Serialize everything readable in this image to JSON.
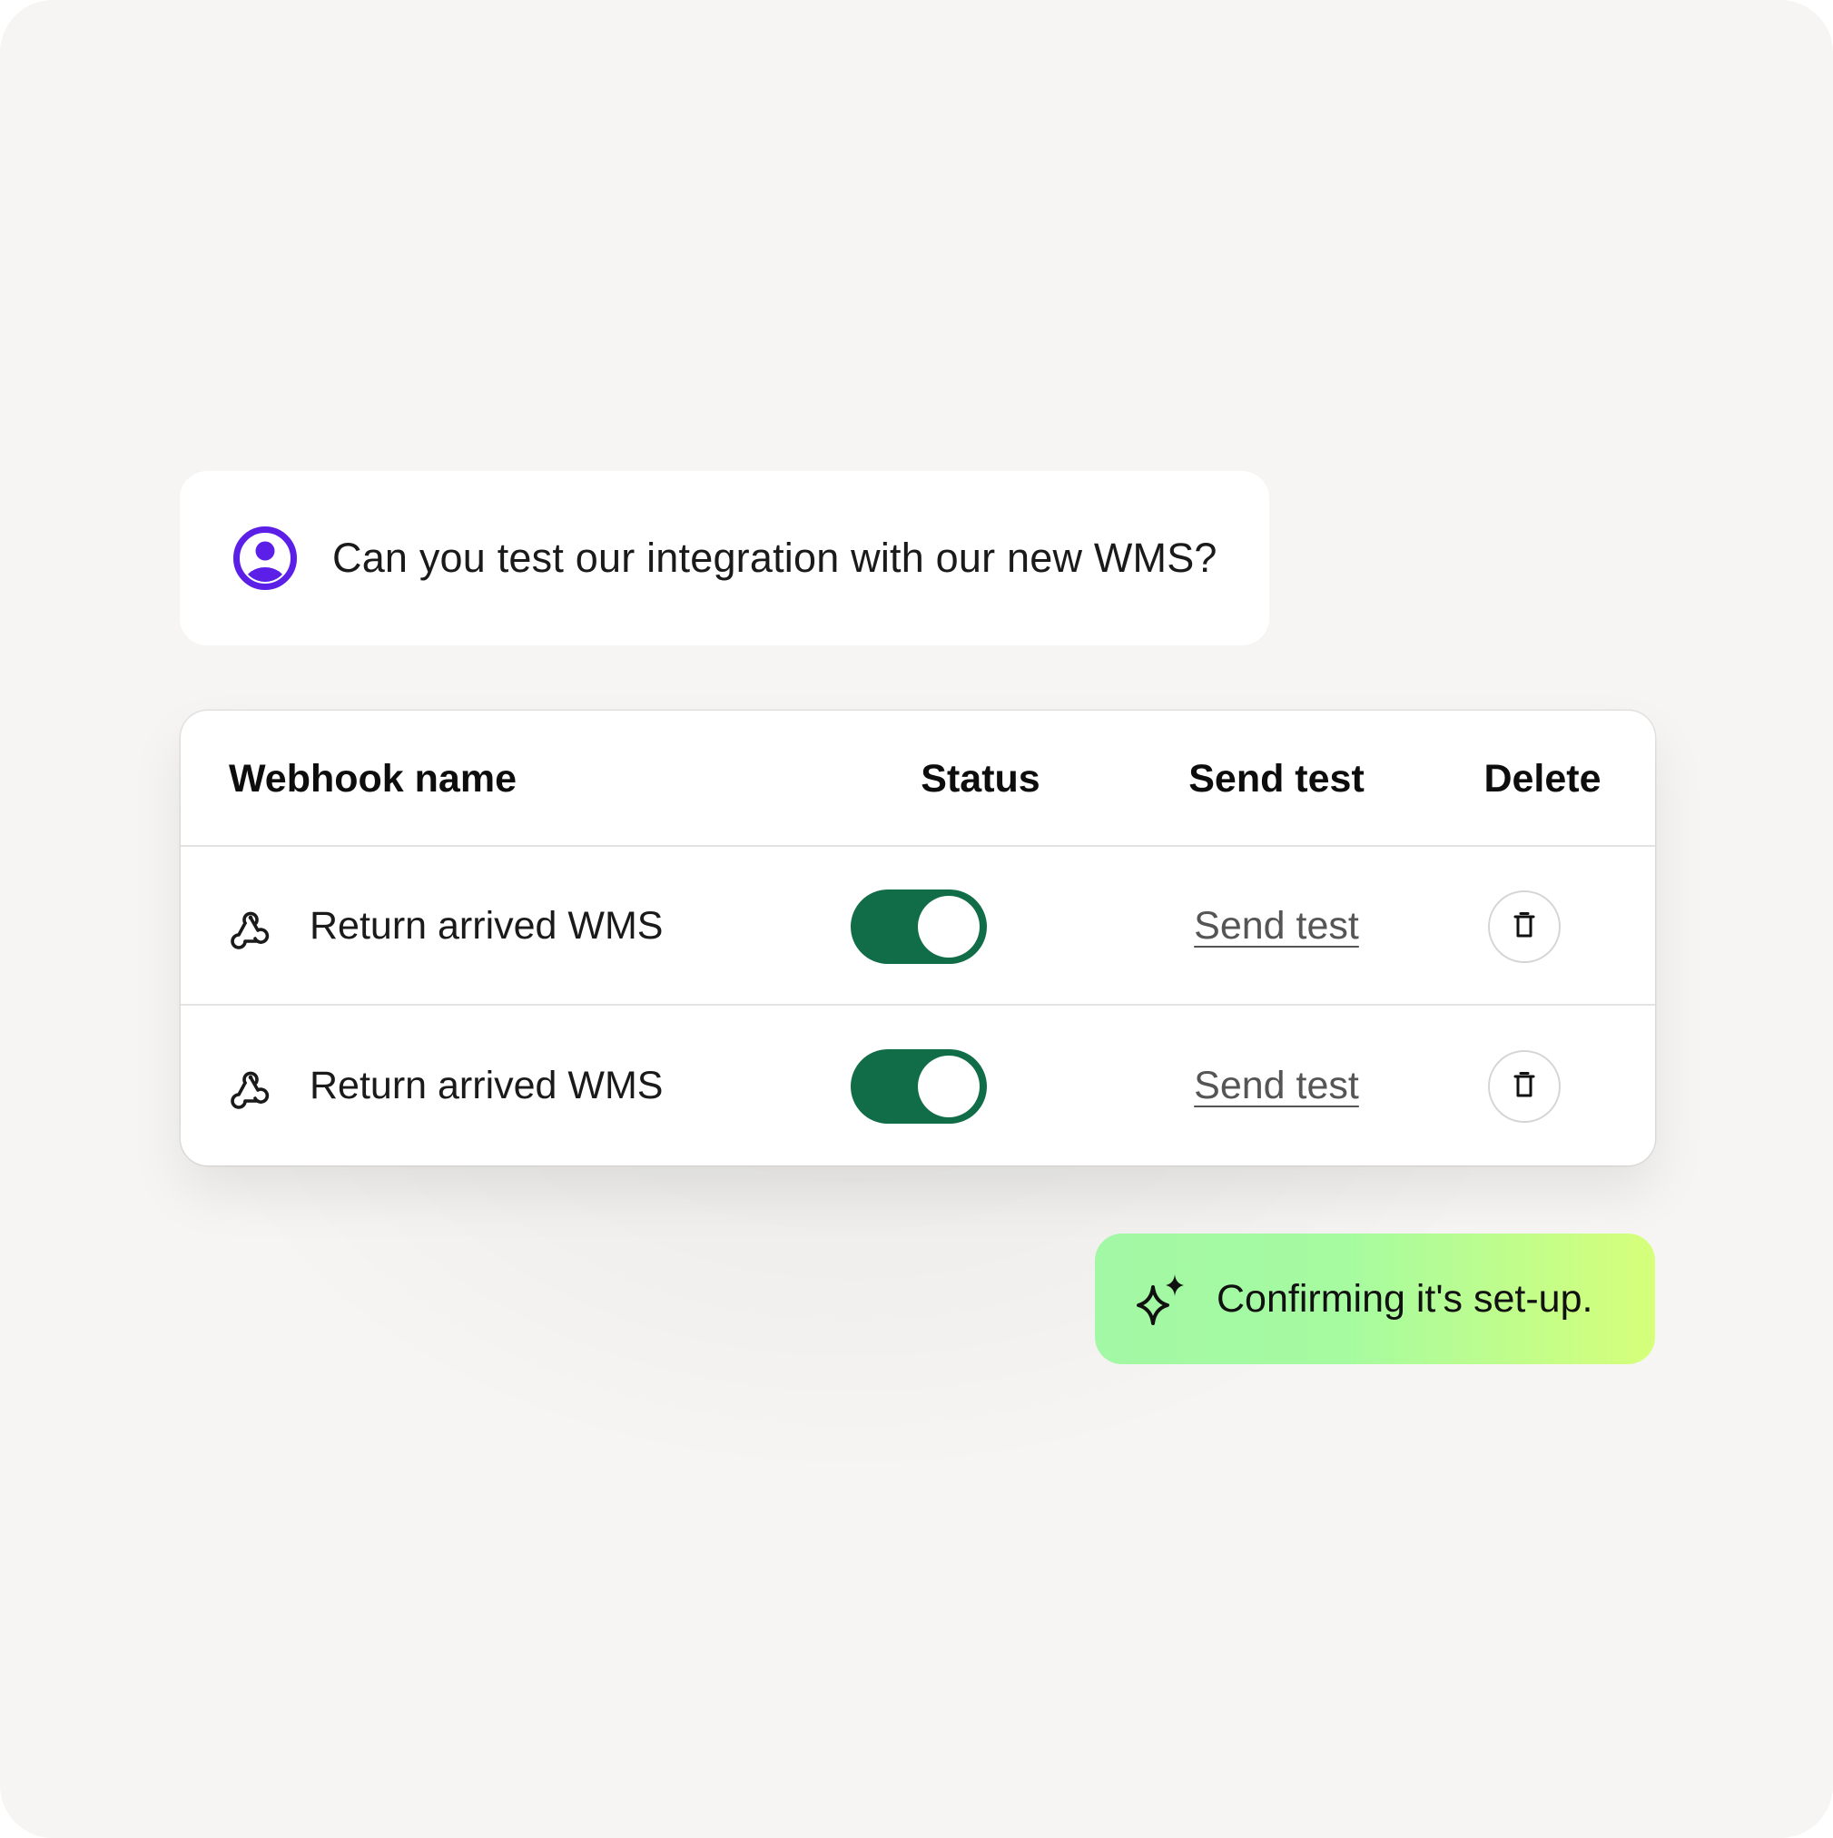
{
  "chat": {
    "message": "Can you test our integration with our new WMS?",
    "avatar_icon": "user-avatar-icon"
  },
  "table": {
    "headers": {
      "name": "Webhook name",
      "status": "Status",
      "send_test": "Send test",
      "delete": "Delete"
    },
    "rows": [
      {
        "name": "Return arrived WMS",
        "status_enabled": true,
        "send_test_label": "Send test"
      },
      {
        "name": "Return arrived WMS",
        "status_enabled": true,
        "send_test_label": "Send test"
      }
    ]
  },
  "confirmation": {
    "text": "Confirming it's set-up.",
    "icon": "sparkle-icon"
  },
  "colors": {
    "accent_purple": "#5b1fe8",
    "toggle_green": "#116d47",
    "background": "#f6f5f3",
    "pill_gradient_start": "#a2f8a4",
    "pill_gradient_end": "#d6ff7a"
  }
}
